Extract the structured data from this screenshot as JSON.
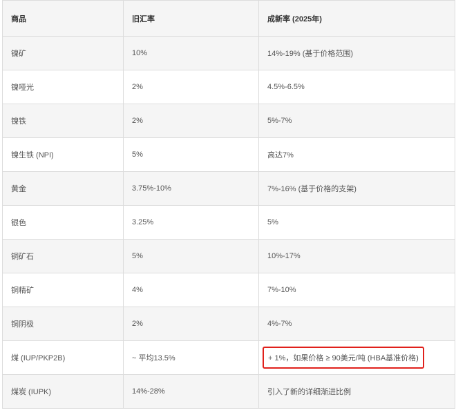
{
  "table": {
    "headers": [
      "商品",
      "旧汇率",
      "成新率 (2025年)"
    ],
    "rows": [
      [
        "镍矿",
        "10%",
        "14%-19% (基于价格范围)"
      ],
      [
        "镍哑光",
        "2%",
        "4.5%-6.5%"
      ],
      [
        "镍铁",
        "2%",
        "5%-7%"
      ],
      [
        "镍生铁 (NPI)",
        "5%",
        "高达7%"
      ],
      [
        "黄金",
        "3.75%-10%",
        "7%-16% (基于价格的支架)"
      ],
      [
        "银色",
        "3.25%",
        "5%"
      ],
      [
        "铜矿石",
        "5%",
        "10%-17%"
      ],
      [
        "铜精矿",
        "4%",
        "7%-10%"
      ],
      [
        "铜阴极",
        "2%",
        "4%-7%"
      ],
      [
        "煤 (IUP/PKP2B)",
        "~ 平均13.5%",
        "+ 1%，如果价格 ≥ 90美元/吨 (HBA基准价格)"
      ],
      [
        "煤炭 (IUPK)",
        "14%-28%",
        "引入了新的详细渐进比例"
      ]
    ],
    "highlight_color": "#e0201b"
  }
}
